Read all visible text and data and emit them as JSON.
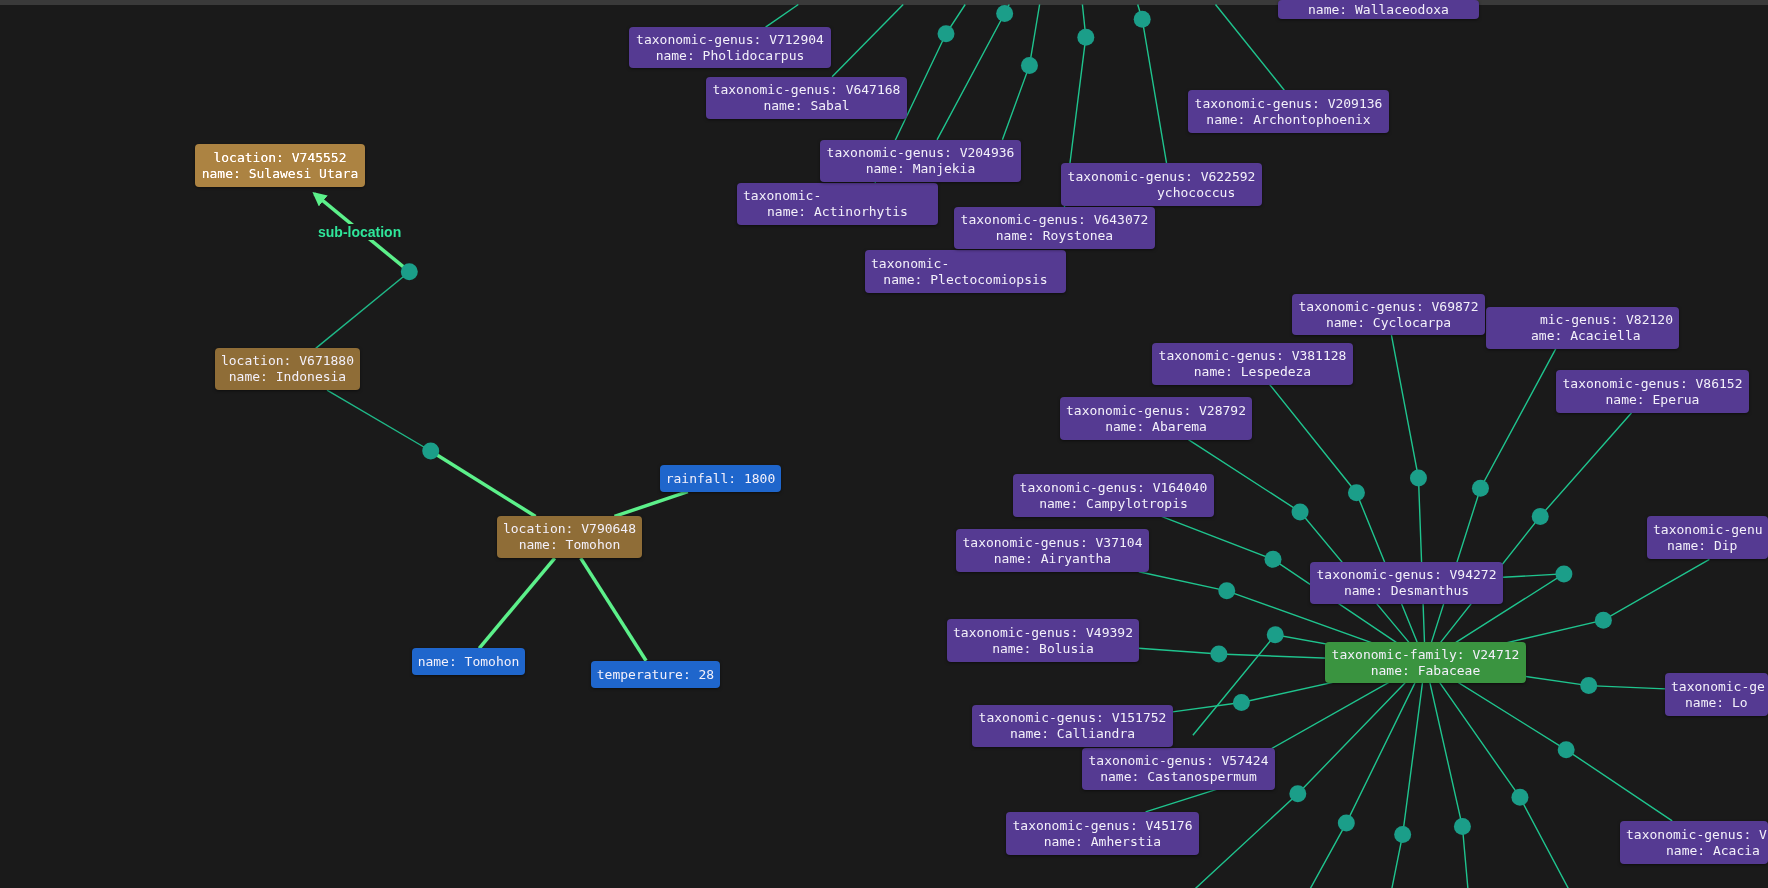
{
  "nodes": [
    {
      "kind": "genus",
      "lines": [
        "name: Wallaceodoxa"
      ]
    },
    {
      "kind": "genus",
      "lines": [
        "taxonomic-genus: V712904",
        "name: Pholidocarpus"
      ]
    },
    {
      "kind": "genus",
      "lines": [
        "taxonomic-genus: V647168",
        "name: Sabal"
      ]
    },
    {
      "kind": "genus",
      "lines": [
        "taxonomic-",
        "name: Actinorhytis"
      ]
    },
    {
      "kind": "genus",
      "lines": [
        "taxonomic-genus: V204936",
        "name: Manjekia"
      ]
    },
    {
      "kind": "genus",
      "lines": [
        "taxonomic-",
        "name: Plectocomiopsis"
      ]
    },
    {
      "kind": "genus",
      "lines": [
        "taxonomic-genus: V622592",
        "ychococcus"
      ]
    },
    {
      "kind": "genus",
      "lines": [
        "taxonomic-genus: V643072",
        "name: Roystonea"
      ]
    },
    {
      "kind": "genus",
      "lines": [
        "taxonomic-genus: V209136",
        "name: Archontophoenix"
      ]
    },
    {
      "kind": "location",
      "lines": [
        "location: V745552",
        "name: Sulawesi Utara"
      ]
    },
    {
      "kind": "location",
      "lines": [
        "location: V671880",
        "name: Indonesia"
      ]
    },
    {
      "kind": "location",
      "lines": [
        "location: V790648",
        "name: Tomohon"
      ]
    },
    {
      "kind": "attribute",
      "lines": [
        "rainfall: 1800"
      ]
    },
    {
      "kind": "attribute",
      "lines": [
        "name: Tomohon"
      ]
    },
    {
      "kind": "attribute",
      "lines": [
        "temperature: 28"
      ]
    },
    {
      "kind": "genus",
      "lines": [
        "mic-genus: V82120",
        "ame: Acaciella"
      ]
    },
    {
      "kind": "genus",
      "lines": [
        "taxonomic-genus: V69872",
        "name: Cyclocarpa"
      ]
    },
    {
      "kind": "genus",
      "lines": [
        "taxonomic-genus: V381128",
        "name: Lespedeza"
      ]
    },
    {
      "kind": "genus",
      "lines": [
        "taxonomic-genus: V28792",
        "name: Abarema"
      ]
    },
    {
      "kind": "genus",
      "lines": [
        "taxonomic-genus: V86152",
        "name: Eperua"
      ]
    },
    {
      "kind": "genus",
      "lines": [
        "taxonomic-genus: V164040",
        "name: Campylotropis"
      ]
    },
    {
      "kind": "genus",
      "lines": [
        "taxonomic-genus: V37104",
        "name: Airyantha"
      ]
    },
    {
      "kind": "genus",
      "lines": [
        "taxonomic-genu",
        "name: Dip"
      ]
    },
    {
      "kind": "genus",
      "lines": [
        "taxonomic-genus: V94272",
        "name: Desmanthus"
      ]
    },
    {
      "kind": "genus",
      "lines": [
        "taxonomic-genus: V49392",
        "name: Bolusia"
      ]
    },
    {
      "kind": "family",
      "lines": [
        "taxonomic-family: V24712",
        "name: Fabaceae"
      ]
    },
    {
      "kind": "genus",
      "lines": [
        "taxonomic-genus: V57424",
        "name: Castanospermum"
      ]
    },
    {
      "kind": "genus",
      "lines": [
        "taxonomic-genus: V151752",
        "name: Calliandra"
      ]
    },
    {
      "kind": "genus",
      "lines": [
        "taxonomic-genus: V45176",
        "name: Amherstia"
      ]
    },
    {
      "kind": "genus",
      "lines": [
        "taxonomic-ge",
        "name: Lo"
      ]
    },
    {
      "kind": "genus",
      "lines": [
        "taxonomic-genus: V",
        "name: Acacia"
      ]
    }
  ],
  "edges": [
    {
      "highlighted": true,
      "label": "sub-location"
    },
    {
      "highlighted": false
    },
    {
      "highlighted": true
    },
    {
      "highlighted": false
    },
    {
      "highlighted": true
    },
    {
      "highlighted": true
    },
    {
      "highlighted": true
    }
  ]
}
